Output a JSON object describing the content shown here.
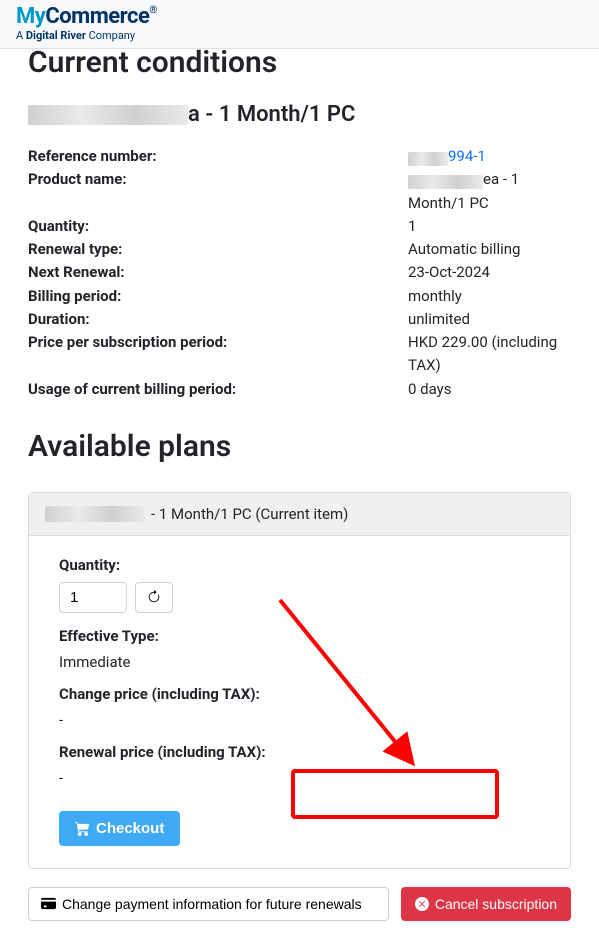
{
  "logo": {
    "part1": "My",
    "part2": "Commerce",
    "reg": "®",
    "sub_a": "A ",
    "sub_dr": "Digital River",
    "sub_company": " Company"
  },
  "headings": {
    "current_conditions": "Current conditions",
    "available_plans": "Available plans"
  },
  "product": {
    "title_suffix": "a - 1 Month/1 PC"
  },
  "labels": {
    "reference_number": "Reference number:",
    "product_name": "Product name:",
    "quantity": "Quantity:",
    "renewal_type": "Renewal type:",
    "next_renewal": "Next Renewal:",
    "billing_period": "Billing period:",
    "duration": "Duration:",
    "price_per_period": "Price per subscription period:",
    "usage_current": "Usage of current billing period:"
  },
  "values": {
    "reference_suffix": "994-1",
    "product_name_suffix": "ea - 1 Month/1 PC",
    "quantity": "1",
    "renewal_type": "Automatic billing",
    "next_renewal": "23-Oct-2024",
    "billing_period": "monthly",
    "duration": "unlimited",
    "price": "HKD 229.00 (including TAX)",
    "usage": "0 days"
  },
  "plan": {
    "title_suffix": " - 1 Month/1 PC (Current item)",
    "quantity_label": "Quantity:",
    "quantity_value": "1",
    "effective_type_label": "Effective Type:",
    "effective_type_value": "Immediate",
    "change_price_label": "Change price (including TAX):",
    "change_price_value": "-",
    "renewal_price_label": "Renewal price (including TAX):",
    "renewal_price_value": "-",
    "checkout_label": "Checkout"
  },
  "bottom": {
    "change_payment_label": "Change payment information for future renewals",
    "cancel_label": "Cancel subscription"
  }
}
